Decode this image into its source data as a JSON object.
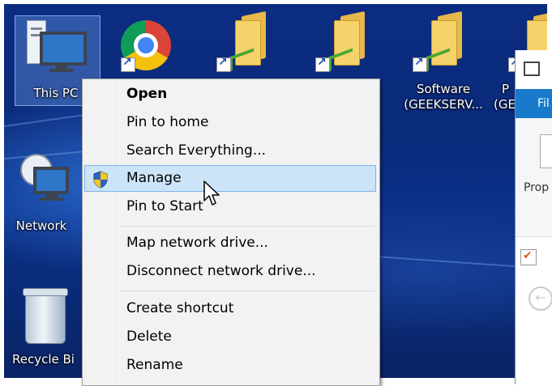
{
  "desktop": {
    "icons": [
      {
        "label": "This PC"
      },
      {
        "label": "Network"
      },
      {
        "label": "Recycle Bi"
      },
      {
        "label_line1": "Software",
        "label_line2": "(GEEKSERV..."
      },
      {
        "label_line1": "P",
        "label_line2": "(GE"
      }
    ]
  },
  "context_menu": {
    "items": [
      {
        "label": "Open"
      },
      {
        "label": "Pin to home"
      },
      {
        "label": "Search Everything..."
      },
      {
        "label": "Manage"
      },
      {
        "label": "Pin to Start"
      },
      {
        "label": "Map network drive..."
      },
      {
        "label": "Disconnect network drive..."
      },
      {
        "label": "Create shortcut"
      },
      {
        "label": "Delete"
      },
      {
        "label": "Rename"
      }
    ]
  },
  "explorer_window": {
    "file_tab": "Fil",
    "properties_label": "Prop",
    "accent_color": "#1979ca"
  }
}
